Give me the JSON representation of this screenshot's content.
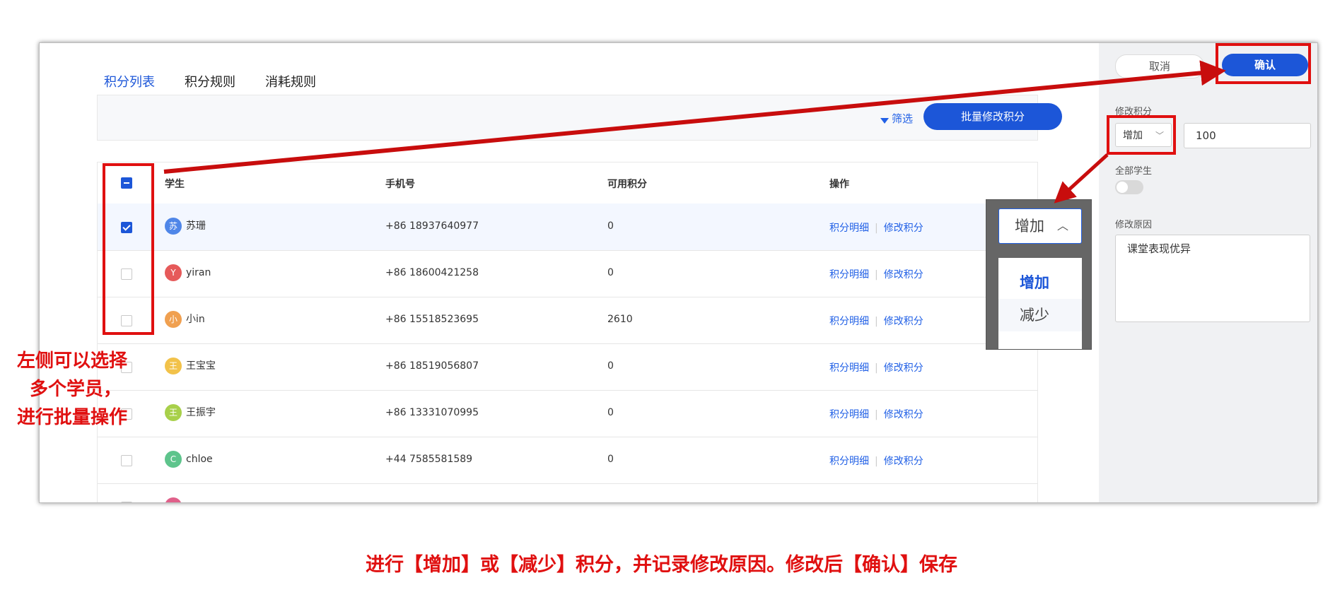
{
  "tabs": [
    {
      "label": "积分列表",
      "active": true
    },
    {
      "label": "积分规则",
      "active": false
    },
    {
      "label": "消耗规则",
      "active": false
    }
  ],
  "toolbar": {
    "filter_label": "筛选",
    "batch_label": "批量修改积分"
  },
  "table": {
    "headers": [
      "学生",
      "手机号",
      "可用积分",
      "操作"
    ],
    "action_detail": "积分明细",
    "action_edit": "修改积分",
    "rows": [
      {
        "avatar": "苏",
        "avatar_color": "#4f86e8",
        "name": "苏珊",
        "phone": "+86 18937640977",
        "points": "0",
        "checked": true
      },
      {
        "avatar": "Y",
        "avatar_color": "#e65a5a",
        "name": "yiran",
        "phone": "+86 18600421258",
        "points": "0",
        "checked": false
      },
      {
        "avatar": "小",
        "avatar_color": "#f0a050",
        "name": "小in",
        "phone": "+86 15518523695",
        "points": "2610",
        "checked": false
      },
      {
        "avatar": "王",
        "avatar_color": "#f2c24a",
        "name": "王宝宝",
        "phone": "+86 18519056807",
        "points": "0",
        "checked": false
      },
      {
        "avatar": "王",
        "avatar_color": "#a8d04a",
        "name": "王振宇",
        "phone": "+86 13331070995",
        "points": "0",
        "checked": false
      },
      {
        "avatar": "C",
        "avatar_color": "#5ec48c",
        "name": "chloe",
        "phone": "+44 7585581589",
        "points": "0",
        "checked": false
      }
    ]
  },
  "panel": {
    "cancel_label": "取消",
    "confirm_label": "确认",
    "modify_label": "修改积分",
    "mode_value": "增加",
    "amount_value": "100",
    "all_students_label": "全部学生",
    "reason_label": "修改原因",
    "reason_value": "课堂表现优异"
  },
  "zoom": {
    "select_value": "增加",
    "options": [
      "增加",
      "减少"
    ]
  },
  "annotations": {
    "left_note": [
      "左侧可以选择",
      "多个学员，",
      "进行批量操作"
    ],
    "caption": "进行【增加】或【减少】积分，并记录修改原因。修改后【确认】保存"
  },
  "colors": {
    "accent": "#1c56d8",
    "annotation": "#e01010"
  }
}
